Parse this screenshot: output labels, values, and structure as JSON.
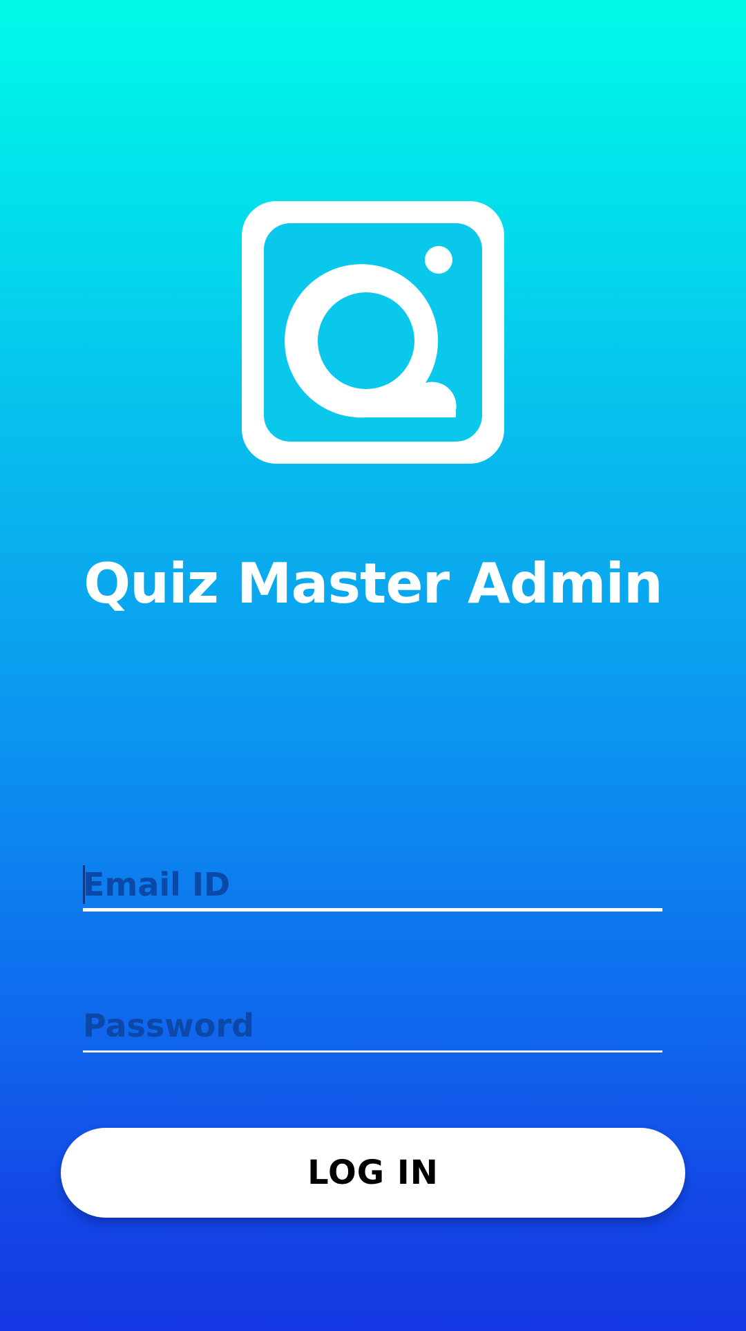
{
  "app": {
    "title": "Quiz Master Admin",
    "logo_icon": "quiz-master-q-logo-icon"
  },
  "form": {
    "email": {
      "value": "",
      "placeholder": "Email ID"
    },
    "password": {
      "value": "",
      "placeholder": "Password"
    },
    "login_label": "LOG IN"
  },
  "colors": {
    "gradient_top": "#00fbe9",
    "gradient_bottom": "#1538e4",
    "placeholder_text": "#0b48a8",
    "button_bg": "#ffffff",
    "button_text": "#000000"
  }
}
